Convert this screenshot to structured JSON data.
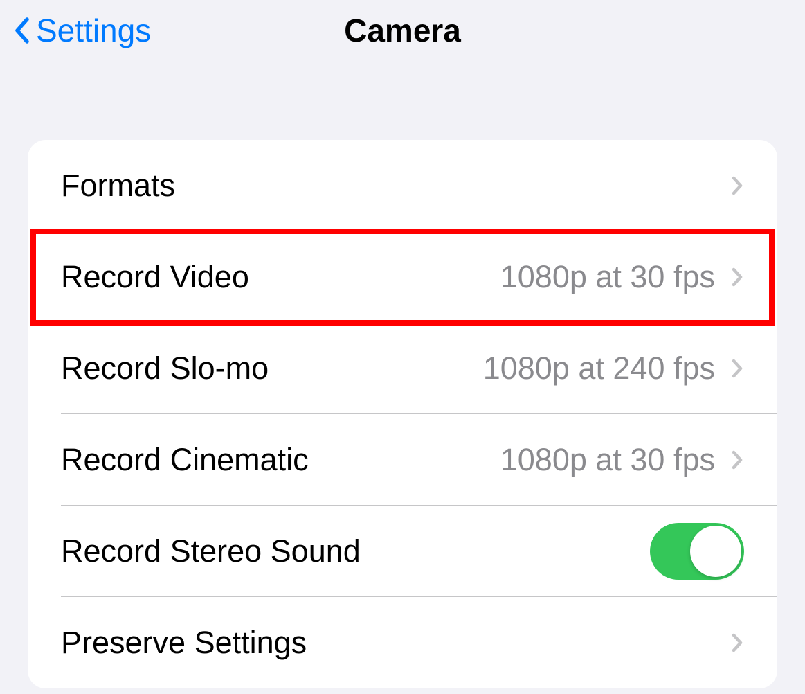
{
  "nav": {
    "back_label": "Settings",
    "title": "Camera"
  },
  "rows": [
    {
      "label": "Formats",
      "value": "",
      "type": "disclosure",
      "highlighted": false
    },
    {
      "label": "Record Video",
      "value": "1080p at 30 fps",
      "type": "disclosure",
      "highlighted": true
    },
    {
      "label": "Record Slo-mo",
      "value": "1080p at 240 fps",
      "type": "disclosure",
      "highlighted": false
    },
    {
      "label": "Record Cinematic",
      "value": "1080p at 30 fps",
      "type": "disclosure",
      "highlighted": false
    },
    {
      "label": "Record Stereo Sound",
      "value": "",
      "type": "toggle",
      "toggle_on": true,
      "highlighted": false
    },
    {
      "label": "Preserve Settings",
      "value": "",
      "type": "disclosure",
      "highlighted": false
    }
  ]
}
